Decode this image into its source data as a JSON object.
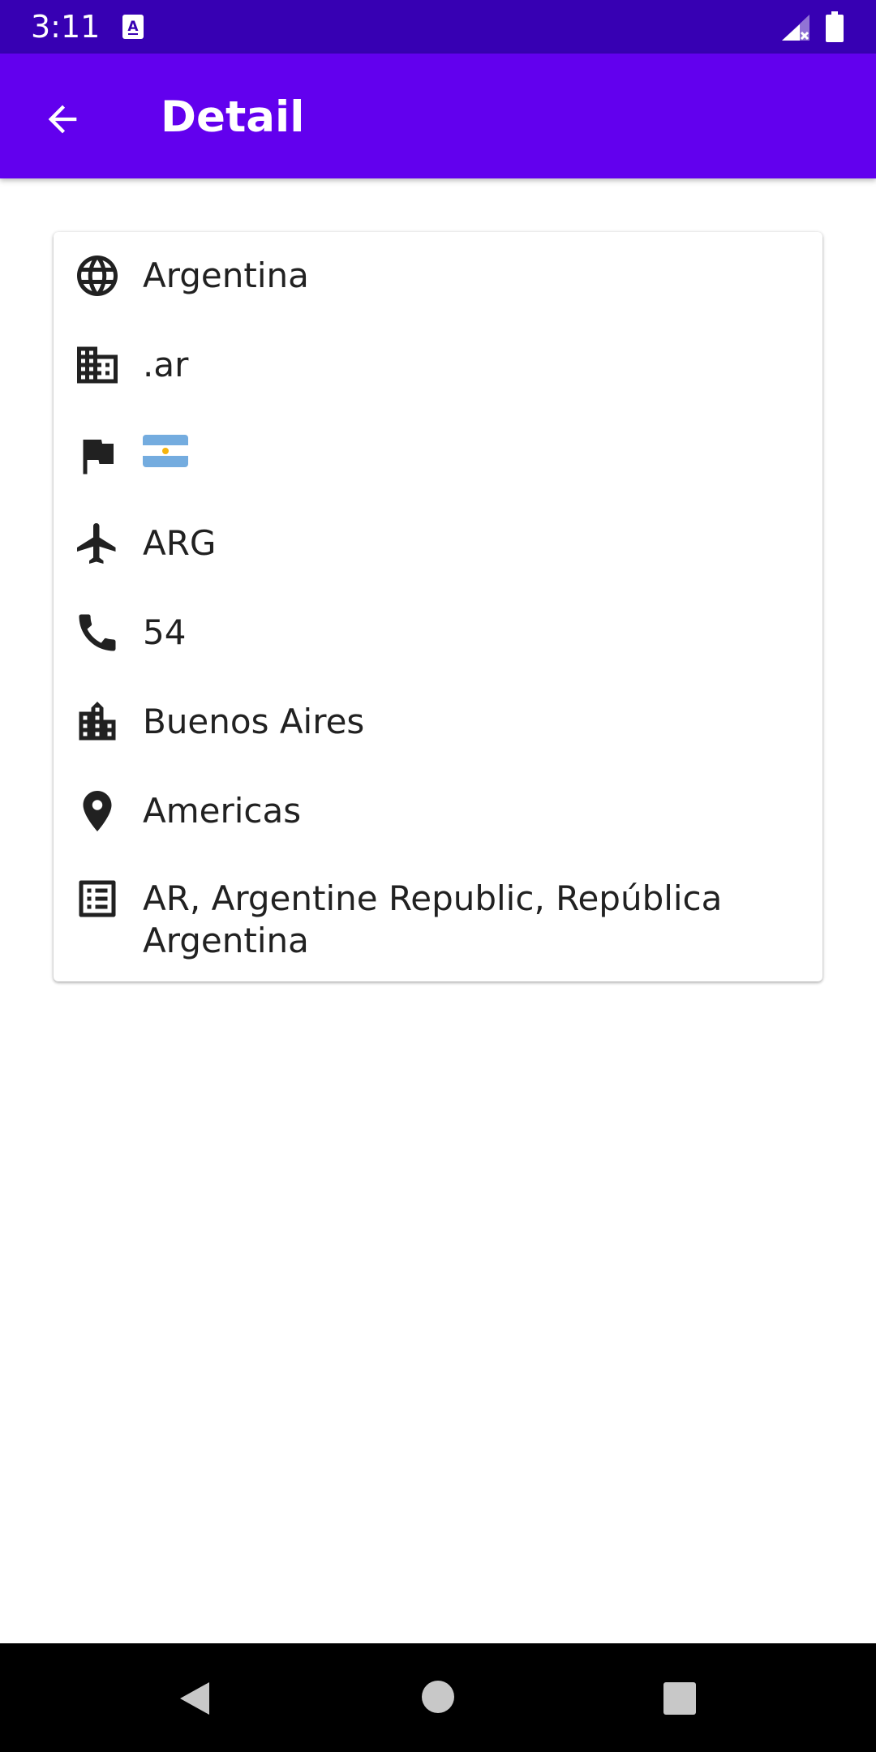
{
  "status_bar": {
    "time": "3:11"
  },
  "app_bar": {
    "title": "Detail"
  },
  "country": {
    "name": "Argentina",
    "tld": ".ar",
    "flag_colors": [
      "#74acdf",
      "#ffffff",
      "#74acdf"
    ],
    "alpha3": "ARG",
    "calling_code": "54",
    "capital": "Buenos Aires",
    "region": "Americas",
    "alt_spellings": "AR, Argentine Republic, República Argentina"
  },
  "colors": {
    "status_bar": "#3700b3",
    "app_bar": "#6200ee",
    "icon": "#212121",
    "text": "#212121"
  },
  "icons": {
    "back": "arrow-left-icon",
    "name": "globe-icon",
    "tld": "building-icon",
    "flag": "flag-icon",
    "alpha3": "airplane-icon",
    "calling_code": "phone-icon",
    "capital": "city-icon",
    "region": "location-pin-icon",
    "alt_spellings": "list-icon"
  }
}
